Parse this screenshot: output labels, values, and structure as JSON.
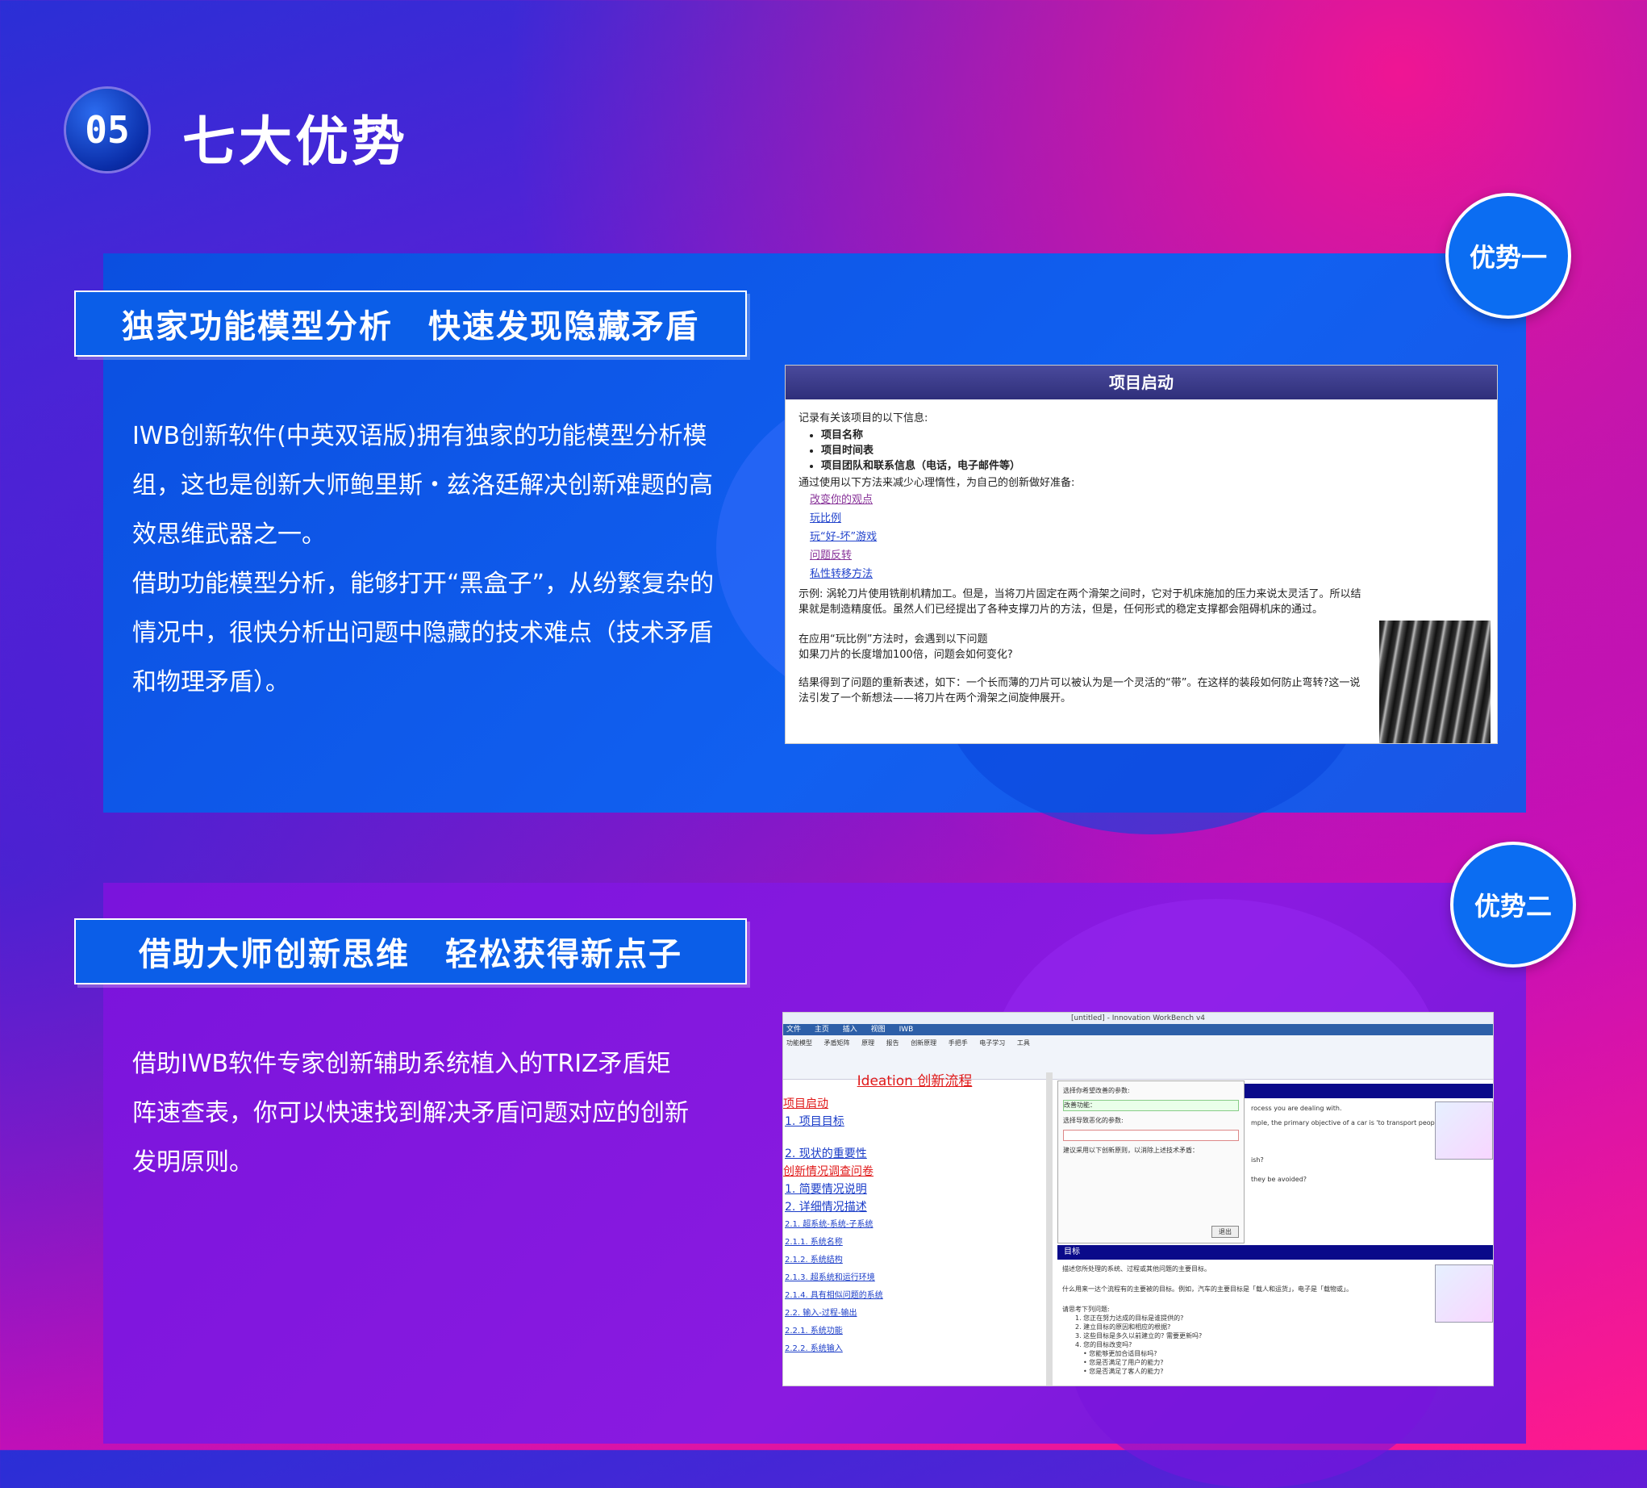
{
  "header": {
    "badge": "05",
    "title": "七大优势"
  },
  "advantage1": {
    "tag": "优势一",
    "title_part1": "独家功能模型分析",
    "title_part2": "快速发现隐藏矛盾",
    "paragraph1": "IWB创新软件(中英双语版)拥有独家的功能模型分析模组，这也是创新大师鲍里斯・兹洛廷解决创新难题的高效思维武器之一。",
    "paragraph2": "借助功能模型分析，能够打开“黑盒子”，从纷繁复杂的情况中，很快分析出问题中隐藏的技术难点（技术矛盾和物理矛盾）。",
    "screenshot": {
      "header": "项目启动",
      "intro": "记录有关该项目的以下信息:",
      "bullets": [
        "项目名称",
        "项目时间表",
        "项目团队和联系信息（电话，电子邮件等）"
      ],
      "method_line": "通过使用以下方法来减少心理惰性，为自己的创新做好准备:",
      "links": [
        "改变你的观点",
        "玩比例",
        "玩“好-坏”游戏",
        "问题反转",
        "私性转移方法"
      ],
      "example": "示例: 涡轮刀片使用铣削机精加工。但是，当将刀片固定在两个滑架之间时，它对于机床施加的压力来说太灵活了。所以结果就是制造精度低。虽然人们已经提出了各种支撑刀片的方法，但是，任何形式的稳定支撑都会阻碍机床的通过。",
      "q1": "在应用“玩比例”方法时，会遇到以下问题",
      "q2": "如果刀片的长度增加100倍，问题会如何变化?",
      "result": "结果得到了问题的重新表述，如下：一个长而薄的刀片可以被认为是一个灵活的“带”。在这样的装段如何防止弯转?这一说法引发了一个新想法——将刀片在两个滑架之间旋伸展开。"
    }
  },
  "advantage2": {
    "tag": "优势二",
    "title_part1": "借助大师创新思维",
    "title_part2": "轻松获得新点子",
    "paragraph": "借助IWB软件专家创新辅助系统植入的TRIZ矛盾矩阵速查表，你可以快速找到解决矛盾问题对应的创新发明原则。",
    "screenshot": {
      "window_title": "[untitled] - Innovation WorkBench v4",
      "menu": [
        "文件",
        "主页",
        "插入",
        "视图",
        "IWB"
      ],
      "ribbon": [
        "功能模型",
        "矛盾矩阵",
        "原理",
        "报告",
        "创新原理",
        "手把手",
        "电子学习",
        "工具"
      ],
      "left_heading": "Ideation 创新流程",
      "left_items": [
        "项目启动",
        "1. 项目目标",
        "2. 现状的重要性",
        "创新情况调查问卷",
        "1. 简要情况说明",
        "2. 详细情况描述",
        "2.1. 超系统-系统-子系统",
        "2.1.1. 系统名称",
        "2.1.2. 系统结构",
        "2.1.3. 超系统和运行环境",
        "2.1.4. 具有相似问题的系统",
        "2.2. 输入-过程-输出",
        "2.2.1. 系统功能",
        "2.2.2. 系统输入"
      ],
      "dialog_label1": "选择你希望改善的参数:",
      "dialog_value1": "改善功能：",
      "dialog_label2": "选择导致恶化的参数:",
      "dialog_hint": "建议采用以下创新原则，以消除上述技术矛盾：",
      "dialog_button": "退出",
      "right_text1": "rocess you are dealing with.",
      "right_text2": "mple, the primary objective of a car is 'to transport people and loads'",
      "right_text3": "ish?",
      "right_text4": "they be avoided?",
      "goal_bar": "目标",
      "goal_text1": "描述您所处理的系统、过程或其他问题的主要目标。",
      "goal_text2": "什么用来一达个流程有的主要被的目标。例如，汽车的主要目标是「载人和运货」，电子是「载物或」。",
      "goal_q": "请思考下列问题:",
      "goal_list": [
        "1. 您正在努力达成的目标是谁提供的?",
        "2. 建立目标的原因和相应的根据?",
        "3. 这些目标是多久以前建立的? 需要更新吗?",
        "4. 您的目标改变吗?",
        "• 您能够更加合适目标吗?",
        "• 您是否满足了用户的能力?",
        "• 您是否满足了客人的能力?"
      ]
    }
  },
  "colors": {
    "panel1": "#0b4fe0",
    "panel2": "#8a1ae0",
    "tag": "#0b6df2",
    "accent_pink": "#ff1a8c"
  }
}
